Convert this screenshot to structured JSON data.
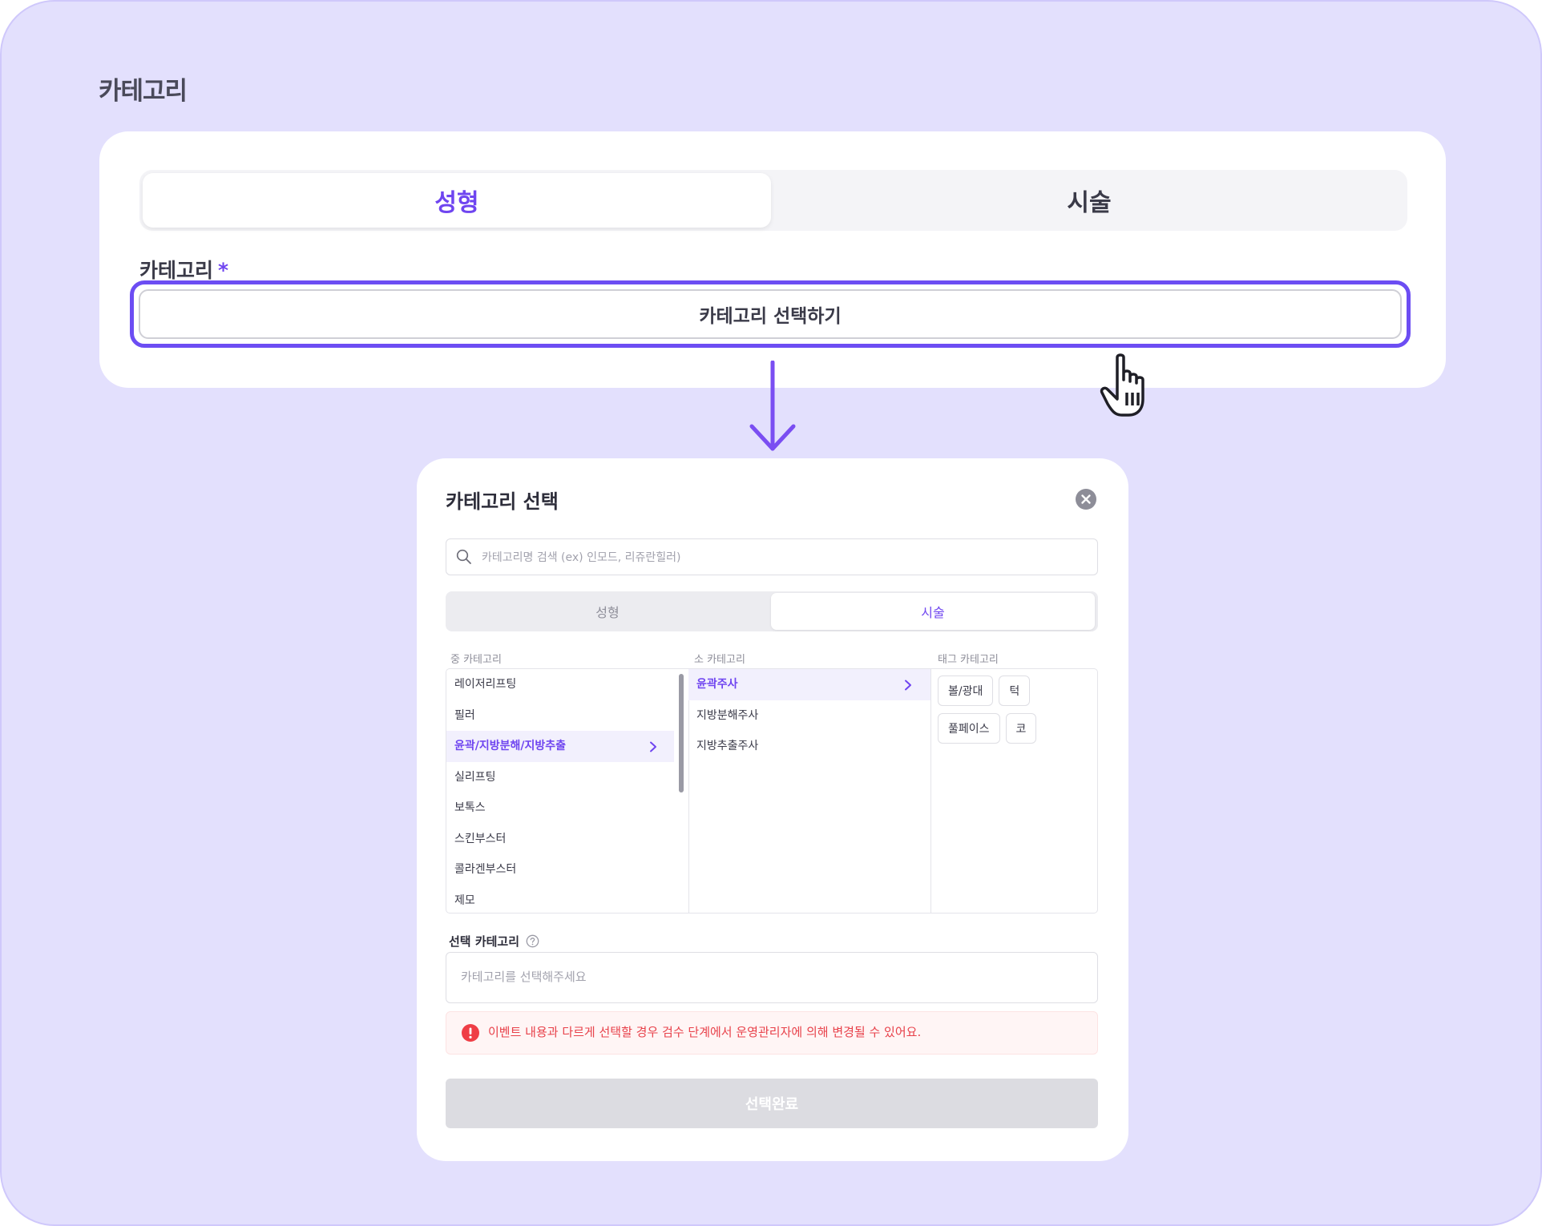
{
  "page": {
    "title": "카테고리"
  },
  "top_card": {
    "tabs": [
      {
        "label": "성형",
        "active": true
      },
      {
        "label": "시술",
        "active": false
      }
    ],
    "field_label": "카테고리",
    "required_mark": "*",
    "select_button": "카테고리 선택하기"
  },
  "modal": {
    "title": "카테고리 선택",
    "search_placeholder": "카테고리명 검색 (ex) 인모드, 리쥬란힐러)",
    "tabs": [
      {
        "label": "성형",
        "active": false
      },
      {
        "label": "시술",
        "active": true
      }
    ],
    "columns": {
      "mid": {
        "header": "중 카테고리",
        "items": [
          "레이저리프팅",
          "필러",
          "윤곽/지방분해/지방추출",
          "실리프팅",
          "보톡스",
          "스킨부스터",
          "콜라겐부스터",
          "제모"
        ],
        "selected_index": 2
      },
      "sub": {
        "header": "소 카테고리",
        "items": [
          "윤곽주사",
          "지방분해주사",
          "지방추출주사"
        ],
        "selected_index": 0
      },
      "tag": {
        "header": "태그 카테고리",
        "items": [
          "볼/광대",
          "턱",
          "풀페이스",
          "코"
        ]
      }
    },
    "selected_label": "선택 카테고리",
    "selected_placeholder": "카테고리를 선택해주세요",
    "warning": "이벤트 내용과 다르게 선택할 경우 검수 단계에서 운영관리자에 의해 변경될 수 있어요.",
    "done_button": "선택완료"
  },
  "icons": [
    "search-icon",
    "close-icon",
    "chevron-right-icon",
    "help-circle-icon",
    "alert-icon",
    "hand-pointer-cursor-icon",
    "down-arrow-icon"
  ],
  "colors": {
    "accent": "#6f45f0",
    "outline": "#6c4df3",
    "background": "#e3e0fd",
    "warning": "#e8414a"
  }
}
